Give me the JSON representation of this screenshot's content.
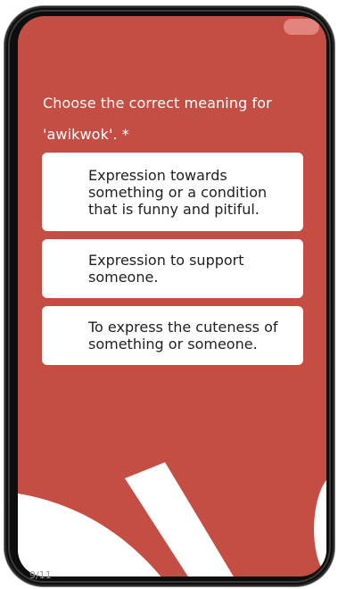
{
  "quiz": {
    "question": "Choose the correct meaning for 'awikwok'. *",
    "options": [
      {
        "label": "Expression towards something or a condition that is funny and pitiful."
      },
      {
        "label": "Expression to support someone."
      },
      {
        "label": "To express the cuteness of something or someone."
      }
    ],
    "progress_text": "9/11"
  },
  "colors": {
    "background": "#c44e43",
    "card": "#ffffff",
    "text_on_bg": "#ffffff",
    "text_on_card": "#1f1f1f"
  }
}
